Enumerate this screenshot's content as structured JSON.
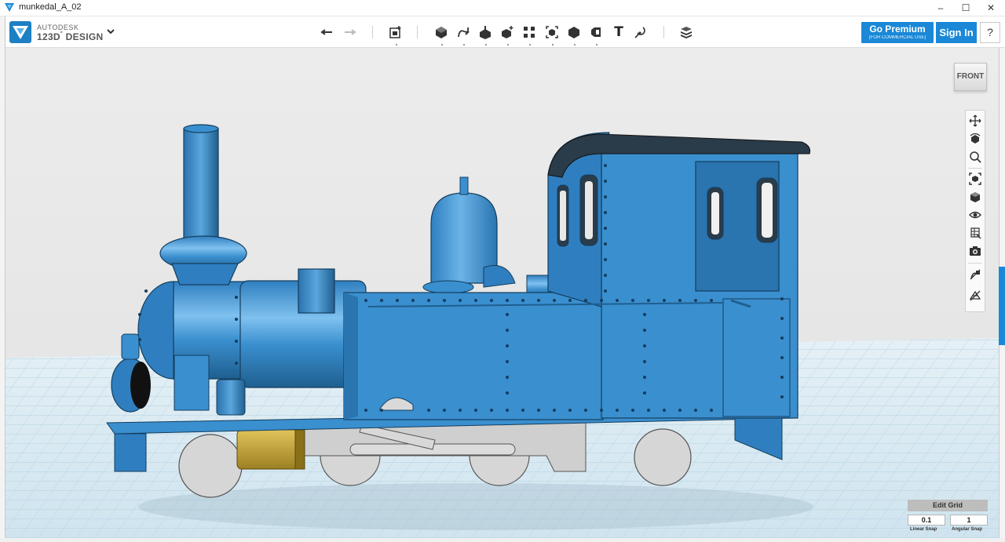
{
  "window": {
    "title": "munkedal_A_02",
    "minimize": "–",
    "maximize": "☐",
    "close": "✕"
  },
  "brand": {
    "line1": "AUTODESK",
    "line2": "123D",
    "line3": "DESIGN",
    "line2_mark": "°"
  },
  "toolbar": {
    "tools": [
      {
        "name": "undo-icon"
      },
      {
        "name": "redo-icon"
      },
      {
        "name": "transform-icon"
      },
      {
        "name": "primitives-icon"
      },
      {
        "name": "sketch-icon"
      },
      {
        "name": "construct-icon"
      },
      {
        "name": "modify-icon"
      },
      {
        "name": "pattern-icon"
      },
      {
        "name": "grouping-icon"
      },
      {
        "name": "combine-icon"
      },
      {
        "name": "measure-icon"
      },
      {
        "name": "text-icon"
      },
      {
        "name": "snap-icon"
      },
      {
        "name": "material-icon"
      }
    ],
    "text_tool_label": "T"
  },
  "premium": {
    "label": "Go Premium",
    "sublabel": "(FOR COMMERCIAL USE)"
  },
  "signin": {
    "label": "Sign In"
  },
  "help": {
    "label": "?"
  },
  "viewcube": {
    "label": "FRONT"
  },
  "nav_tools": [
    "pan-icon",
    "orbit-icon",
    "zoom-icon",
    "fit-icon",
    "default-view-icon",
    "visibility-icon",
    "materials-outlines-icon",
    "screenshot-icon",
    "hide-sketch-icon",
    "hide-mesh-icon"
  ],
  "grid": {
    "edit_label": "Edit Grid",
    "linear_snap_value": "0.1",
    "angular_snap_value": "1",
    "linear_snap_label": "Linear Snap",
    "angular_snap_label": "Angular Snap"
  },
  "colors": {
    "accent": "#1a88d6",
    "model_blue": "#3a8fcf",
    "model_dark": "#1f5f8f",
    "roof": "#2a3b4a",
    "grid_floor": "#dcecf4",
    "brass": "#c8a93a",
    "wheel": "#d4d4d4"
  }
}
